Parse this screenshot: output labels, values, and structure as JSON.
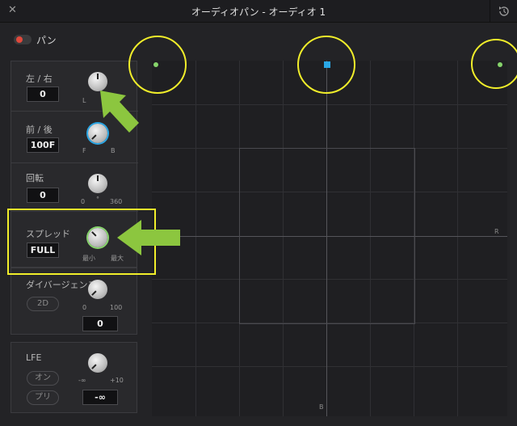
{
  "window": {
    "title": "オーディオパン - オーディオ 1"
  },
  "pan": {
    "label": "パン"
  },
  "rows": {
    "lr": {
      "label": "左 / 右",
      "value": "0",
      "min_label": "L"
    },
    "fb": {
      "label": "前 / 後",
      "value": "100F",
      "min_label": "F",
      "max_label": "B"
    },
    "rotation": {
      "label": "回転",
      "value": "0",
      "min_label": "0",
      "mid_label": "°",
      "max_label": "360"
    },
    "spread": {
      "label": "スプレッド",
      "value": "FULL",
      "min_label": "最小",
      "max_label": "最大"
    },
    "divergence": {
      "label": "ダイバージェンス",
      "mode": "2D",
      "value": "0",
      "min_label": "0",
      "max_label": "100"
    },
    "lfe": {
      "label": "LFE",
      "on_label": "オン",
      "pre_label": "プリ",
      "value": "-∞",
      "min_label": "-∞",
      "max_label": "+10"
    }
  },
  "grid": {
    "right_label": "R",
    "bottom_label": "B"
  },
  "colors": {
    "accent_blue": "#2aa7e6",
    "speaker_green": "#86d46b",
    "highlight_yellow": "#f1ee2a",
    "arrow_green": "#8cc63f",
    "toggle_red": "#e0493c"
  }
}
